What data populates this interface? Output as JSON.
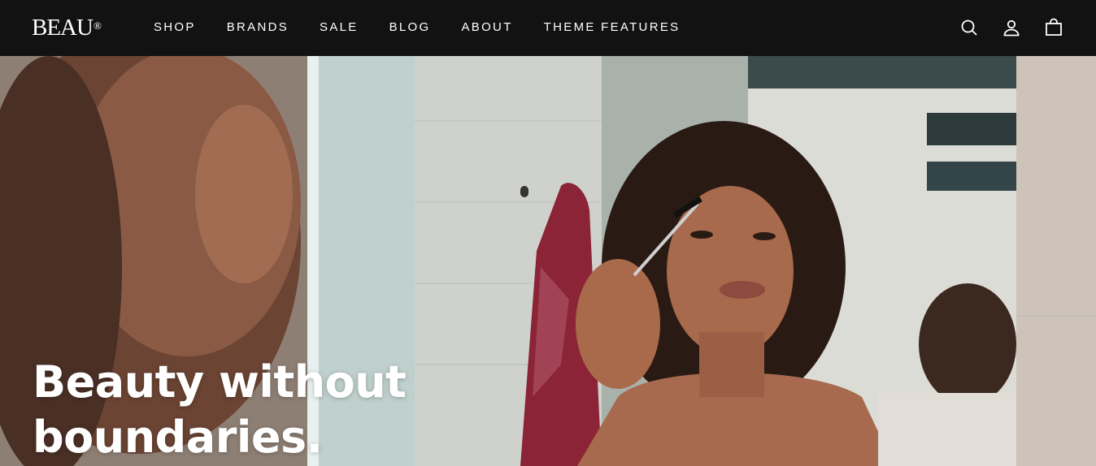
{
  "brand": {
    "name": "BEAU",
    "mark": "®"
  },
  "nav": {
    "items": [
      {
        "label": "SHOP"
      },
      {
        "label": "BRANDS"
      },
      {
        "label": "SALE"
      },
      {
        "label": "BLOG"
      },
      {
        "label": "ABOUT"
      },
      {
        "label": "THEME FEATURES"
      }
    ]
  },
  "header_icons": [
    "search-icon",
    "account-icon",
    "cart-icon"
  ],
  "hero": {
    "title_line1": "Beauty without",
    "title_line2": "boundaries.",
    "image_alt": "Woman applying brow gel in a bathroom mirror"
  },
  "colors": {
    "header_bg": "#121212",
    "text_on_dark": "#ffffff"
  }
}
